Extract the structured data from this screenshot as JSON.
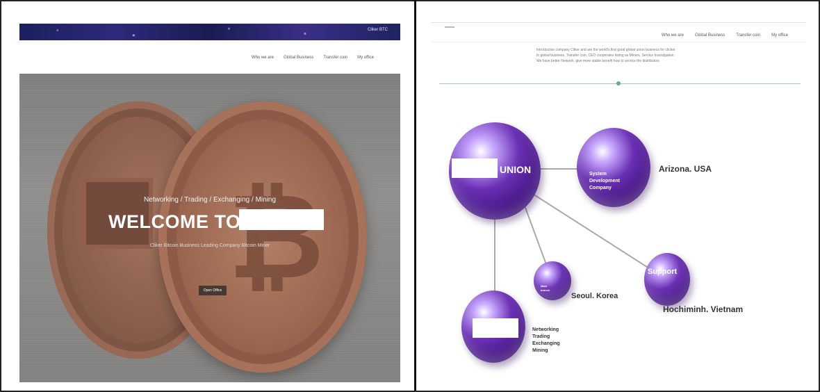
{
  "left_site": {
    "topbar_text": "Cliker BTC",
    "nav": [
      "Who we are",
      "Global Business",
      "Transfer coin",
      "My office"
    ],
    "hero": {
      "subtitle": "Networking / Trading / Exchanging / Mining",
      "title": "WELCOME TO",
      "tagline": "Cliker Bitcoin Business Leading Company Bitcoin Miner",
      "button_label": "Open Office"
    }
  },
  "right_site": {
    "nav": [
      "Who we are",
      "Global Business",
      "Transfer coin",
      "My office"
    ],
    "intro_lines": [
      "Introduction company Cliker and are the world's first good global union business for clicker",
      "In global business, Transfer coin, CEO cooperates listing as Miners, Service Investigation",
      "We have better Network, give more stable benefit how to service the distributors"
    ],
    "diagram": {
      "hub_label": "UNION",
      "node_system": [
        "System",
        "Development",
        "Company"
      ],
      "caption_arizona": "Arizona. USA",
      "node_korea": [
        "Main",
        "branch"
      ],
      "caption_korea": "Seoul. Korea",
      "node_support": "Support",
      "caption_vietnam": "Hochiminh. Vietnam",
      "bottom_list": [
        "Networking",
        "Trading",
        "Exchanging",
        "Mining"
      ]
    }
  }
}
